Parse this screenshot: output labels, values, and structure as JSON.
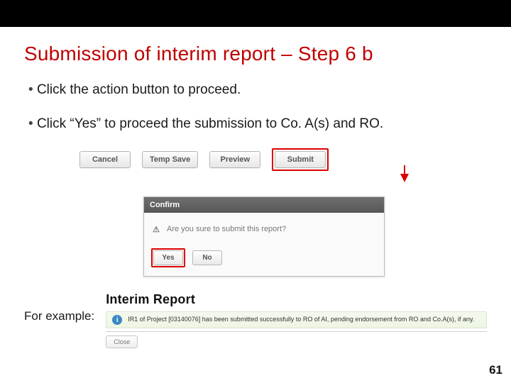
{
  "slide": {
    "title": "Submission of interim report – Step 6 b",
    "bullets": [
      "Click the action button to proceed.",
      "Click “Yes” to proceed the submission to Co. A(s) and RO."
    ],
    "page": "61",
    "for_example": "For example:"
  },
  "actions": {
    "cancel": "Cancel",
    "temp_save": "Temp Save",
    "preview": "Preview",
    "submit": "Submit"
  },
  "dialog": {
    "header": "Confirm",
    "message": "Are you sure to submit this report?",
    "yes": "Yes",
    "no": "No"
  },
  "interim": {
    "heading": "Interim Report",
    "message": "IR1 of Project [03140076] has been submitted successfully to RO of AI, pending endorsement from RO and Co.A(s), if any.",
    "close": "Close"
  }
}
